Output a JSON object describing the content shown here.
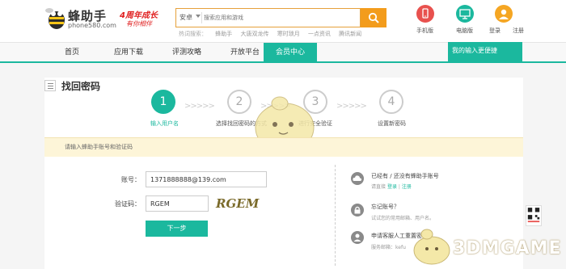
{
  "header": {
    "logo_title": "蜂助手",
    "logo_domain": "phone580.com",
    "badge_line1": "4周年成长",
    "badge_line2": "有你相伴",
    "search": {
      "category": "安卓",
      "placeholder": "搜索应用和游戏"
    },
    "hot_label": "热词搜索：",
    "hot_words": [
      "蜂助手",
      "大唐双龙传",
      "寒时琐月",
      "一点资讯",
      "腾讯新闻"
    ],
    "actions": [
      {
        "label": "手机版",
        "icon": "phone-icon",
        "color": "#e8514e"
      },
      {
        "label": "电脑版",
        "icon": "monitor-icon",
        "color": "#1bb89e"
      },
      {
        "label": "登录",
        "icon": "user-icon",
        "color": "#f5a623"
      },
      {
        "label": "注册",
        "icon": "",
        "color": ""
      }
    ]
  },
  "nav": {
    "items": [
      "首页",
      "应用下载",
      "评测攻略",
      "开放平台",
      "会员中心"
    ],
    "active_index": 4,
    "promo_text": "我的输入更便捷"
  },
  "page": {
    "title": "找回密码"
  },
  "steps": [
    {
      "number": "1",
      "label": "输入用户名",
      "active": true
    },
    {
      "number": "2",
      "label": "选择找回密码的方式",
      "active": false
    },
    {
      "number": "3",
      "label": "进行安全验证",
      "active": false
    },
    {
      "number": "4",
      "label": "设置新密码",
      "active": false
    }
  ],
  "notice": "请输入蜂助手账号和验证码",
  "form": {
    "account_label": "账号：",
    "account_value": "1371888888@139.com",
    "captcha_label": "验证码：",
    "captcha_value": "RGEM",
    "captcha_image_text": "RGEM",
    "submit_label": "下一步"
  },
  "sidebar": {
    "items": [
      {
        "title": "已经有 / 还没有蜂助手账号",
        "sub_prefix": "请直接",
        "link1": "登录",
        "sep": "|",
        "link2": "注册",
        "icon": "cloud-icon"
      },
      {
        "title": "忘记账号？",
        "sub": "试试您的常用邮箱、用户名。",
        "icon": "lock-icon"
      },
      {
        "title": "申请客服人工重置密码",
        "sub": "服务邮箱：kefu",
        "icon": "person-icon"
      }
    ]
  },
  "watermark": "3DMGAME",
  "colors": {
    "accent": "#1bb89e",
    "search_orange": "#f39c1c",
    "notice_bg": "#fdf5d8"
  }
}
